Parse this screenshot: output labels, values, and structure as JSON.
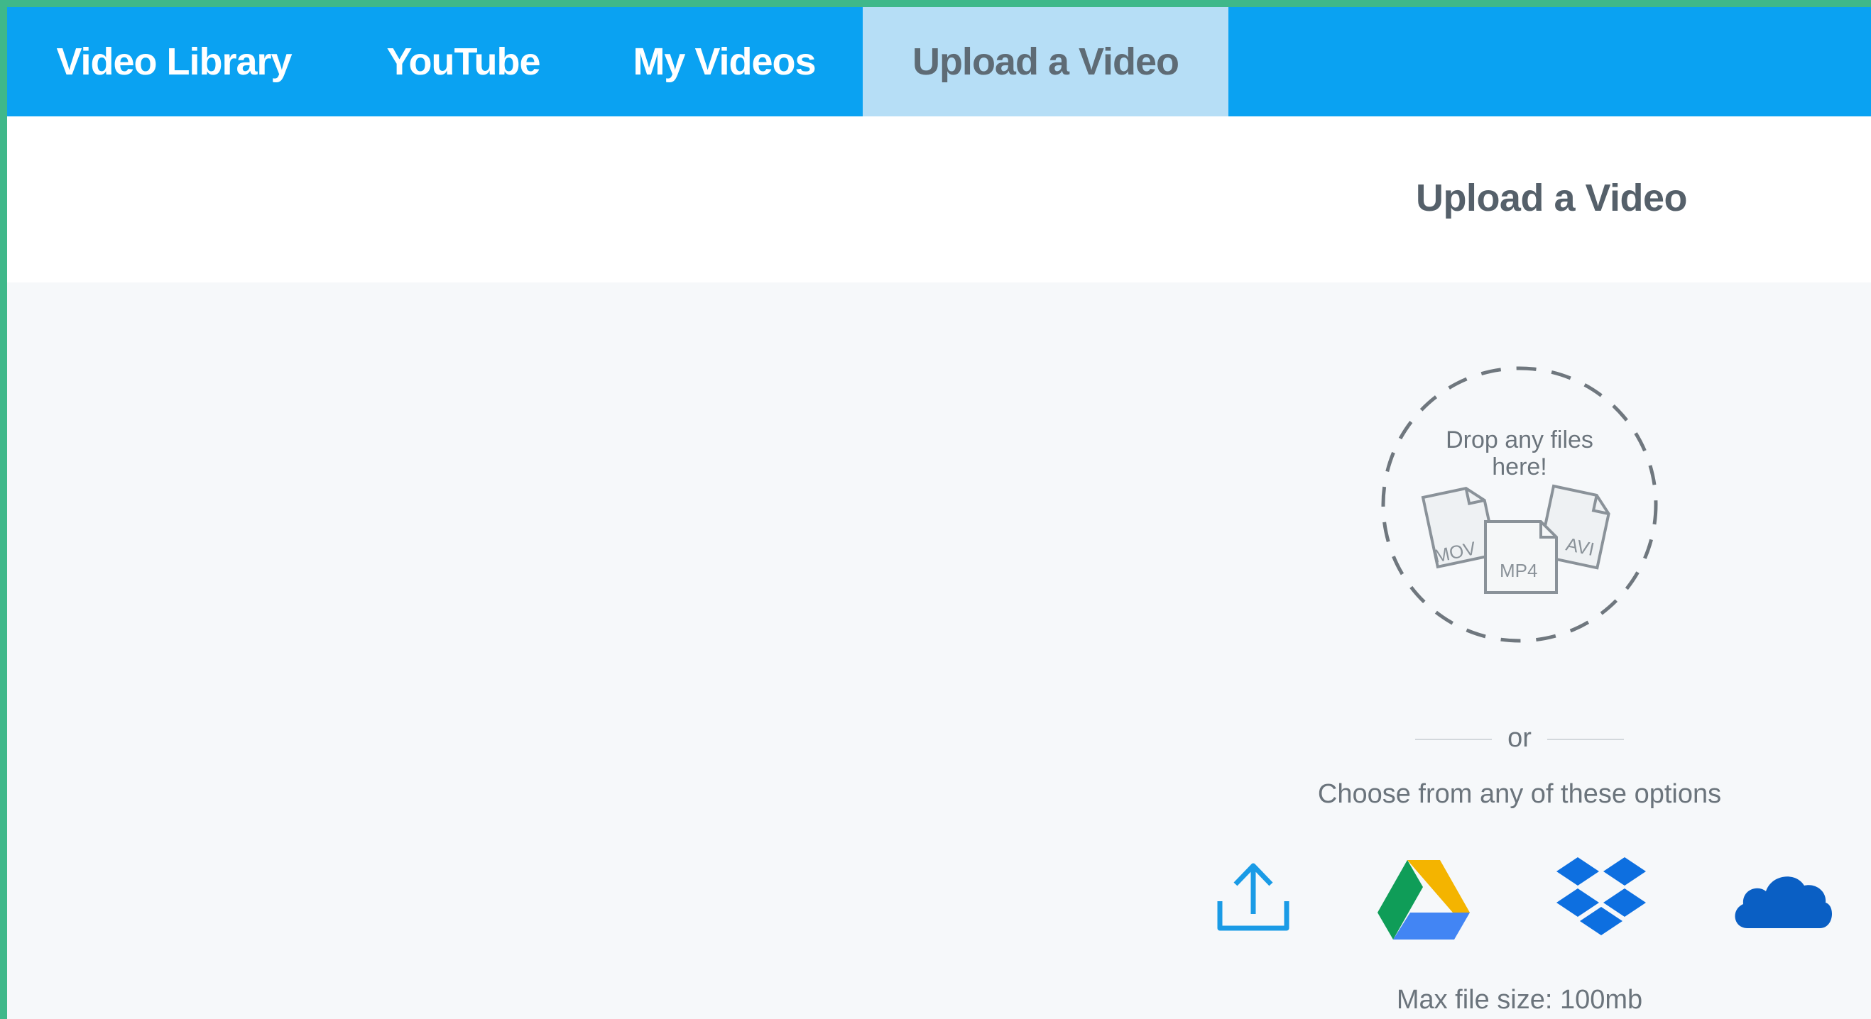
{
  "nav": {
    "tabs": [
      {
        "label": "Video Library",
        "active": false
      },
      {
        "label": "YouTube",
        "active": false
      },
      {
        "label": "My Videos",
        "active": false
      },
      {
        "label": "Upload a Video",
        "active": true
      }
    ]
  },
  "main": {
    "title": "Upload a Video",
    "dropzone": {
      "text": "Drop any files here!",
      "file_types": [
        "MOV",
        "MP4",
        "AVI"
      ]
    },
    "divider_text": "or",
    "choose_text": "Choose from any of these options",
    "options": [
      {
        "icon": "upload-icon"
      },
      {
        "icon": "google-drive-icon"
      },
      {
        "icon": "dropbox-icon"
      },
      {
        "icon": "onedrive-icon"
      }
    ],
    "max_size_text": "Max file size: 100mb"
  },
  "colors": {
    "nav_bg": "#0aa2f2",
    "active_tab_bg": "#b6def6",
    "frame_border": "#3fb88a",
    "upload_icon": "#1a9be6",
    "drive_green": "#0f9d58",
    "drive_yellow": "#f4b400",
    "drive_blue": "#4285f4",
    "dropbox_blue": "#0d6fe0",
    "onedrive_blue": "#0a5fc4"
  }
}
